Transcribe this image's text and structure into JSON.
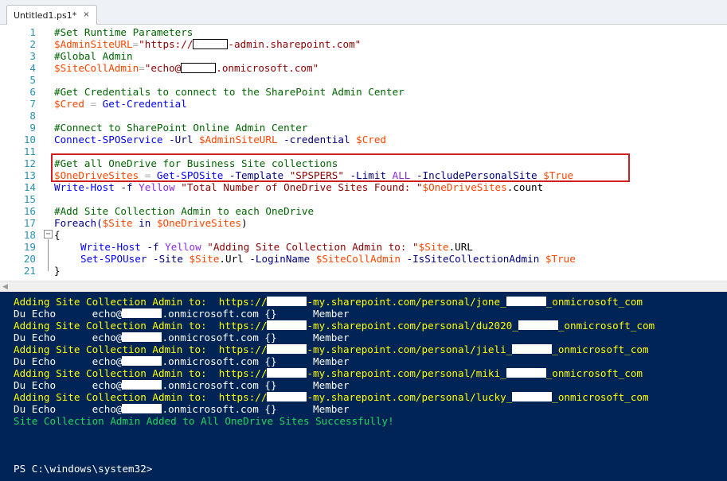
{
  "tab": {
    "label": "Untitled1.ps1*",
    "close": "×"
  },
  "editor": {
    "line_numbers": [
      "1",
      "2",
      "3",
      "4",
      "5",
      "6",
      "7",
      "8",
      "9",
      "10",
      "11",
      "12",
      "13",
      "14",
      "15",
      "16",
      "17",
      "18",
      "19",
      "20",
      "21"
    ],
    "lines": {
      "l1": "#Set Runtime Parameters",
      "l2_var": "$AdminSiteURL",
      "l2_op": "=",
      "l2_str_a": "\"https://",
      "l2_str_b": "-admin.sharepoint.com\"",
      "l3": "#Global Admin",
      "l4_var": "$SiteCollAdmin",
      "l4_op": "=",
      "l4_str_a": "\"echo@",
      "l4_str_b": ".onmicrosoft.com\"",
      "l6": "#Get Credentials to connect to the SharePoint Admin Center",
      "l7_var": "$Cred",
      "l7_op": " = ",
      "l7_cmd": "Get-Credential",
      "l9": "#Connect to SharePoint Online Admin Center",
      "l10_cmd": "Connect-SPOService",
      "l10_p1": " -Url ",
      "l10_v1": "$AdminSiteURL",
      "l10_p2": " -credential ",
      "l10_v2": "$Cred",
      "l12": "#Get all OneDrive for Business Site collections",
      "l13_var": "$OneDriveSites",
      "l13_op": " = ",
      "l13_cmd": "Get-SPOSite",
      "l13_p1": " -Template ",
      "l13_str": "\"SPSPERS\"",
      "l13_p2": " -Limit ",
      "l13_c1": "ALL",
      "l13_p3": " -IncludePersonalSite ",
      "l13_v2": "$True",
      "l14_cmd": "Write-Host",
      "l14_p1": " -f ",
      "l14_c1": "Yellow",
      "l14_str": " \"Total Number of OneDrive Sites Found: \"",
      "l14_var": "$OneDriveSites",
      "l14_prop": ".count",
      "l16": "#Add Site Collection Admin to each OneDrive",
      "l17_kw": "Foreach(",
      "l17_v1": "$Site",
      "l17_in": " in ",
      "l17_v2": "$OneDriveSites",
      "l17_close": ")",
      "l18": "{",
      "l19_cmd": "Write-Host",
      "l19_p1": " -f ",
      "l19_c1": "Yellow",
      "l19_str": " \"Adding Site Collection Admin to: \"",
      "l19_var": "$Site",
      "l19_prop": ".URL",
      "l20_cmd": "Set-SPOUser",
      "l20_p1": " -Site ",
      "l20_v1": "$Site",
      "l20_prop": ".Url",
      "l20_p2": " -LoginName ",
      "l20_v2": "$SiteCollAdmin",
      "l20_p3": " -IsSiteCollectionAdmin ",
      "l20_v3": "$True",
      "l21": "}"
    },
    "fold_minus": "−"
  },
  "scrollbar": {
    "left_arrow": "◀"
  },
  "console": {
    "adding_prefix": "Adding Site Collection Admin to:  https://",
    "user_line_a": "Du Echo      echo@",
    "user_line_b": ".onmicrosoft.com {}      Member",
    "urls": [
      {
        "a": "-my.sharepoint.com/personal/jone_",
        "b": "_onmicrosoft_com"
      },
      {
        "a": "-my.sharepoint.com/personal/du2020_",
        "b": "_onmicrosoft_com"
      },
      {
        "a": "-my.sharepoint.com/personal/jieli_",
        "b": "_onmicrosoft_com"
      },
      {
        "a": "-my.sharepoint.com/personal/miki_",
        "b": "_onmicrosoft_com"
      },
      {
        "a": "-my.sharepoint.com/personal/lucky_",
        "b": "_onmicrosoft_com"
      }
    ],
    "success": "Site Collection Admin Added to All OneDrive Sites Successfully!",
    "prompt": "PS C:\\windows\\system32>"
  },
  "colors": {
    "console_bg": "#012456",
    "highlight_border": "#d11f1f",
    "line_number": "#2b91af",
    "comment": "#006400",
    "variable": "#ff4500"
  }
}
